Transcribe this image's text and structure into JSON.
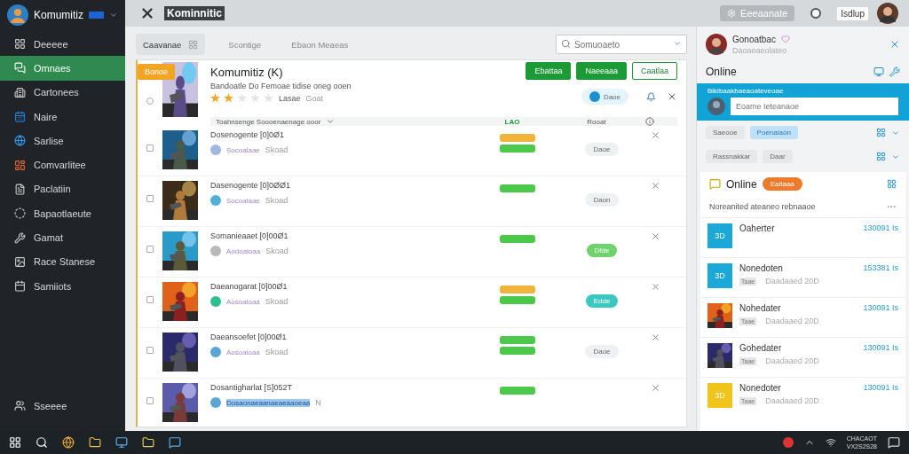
{
  "account": {
    "name": "Komumitiz"
  },
  "sidebar": {
    "items": [
      {
        "label": "Deeeee",
        "selected": false
      },
      {
        "label": "Omnaes",
        "selected": true
      },
      {
        "label": "Cartonees",
        "selected": false
      },
      {
        "label": "Naire",
        "selected": false
      },
      {
        "label": "Sarlise",
        "selected": false
      },
      {
        "label": "Comvarlitee",
        "selected": false
      },
      {
        "label": "Paclatiin",
        "selected": false
      },
      {
        "label": "Bapaotlaeute",
        "selected": false
      },
      {
        "label": "Gamat",
        "selected": false
      },
      {
        "label": "Race Stanese",
        "selected": false
      },
      {
        "label": "Samiiots",
        "selected": false
      }
    ],
    "footer": "Sseeee"
  },
  "header": {
    "title": "Kominnitic",
    "action": "Eeeaanate",
    "badge": "Isdlup"
  },
  "tabs": [
    {
      "label": "Caavanae",
      "selected": true
    },
    {
      "label": "Scontige",
      "selected": false
    },
    {
      "label": "Ebaon Meaeas",
      "selected": false
    }
  ],
  "search": {
    "placeholder": "Somuoaeto"
  },
  "actions": [
    {
      "label": "Ebattaa",
      "kind": "solid"
    },
    {
      "label": "Naeeaaa",
      "kind": "solid"
    },
    {
      "label": "Caatlaa",
      "kind": "outline"
    }
  ],
  "feature": {
    "badge": "Bonoe",
    "title": "Komumitiz (K)",
    "description": "Bandoatle Do Femoae tidise oneg ooen",
    "stars": 2,
    "rating_label": "Lasae",
    "rating_note": "Goat",
    "chip": "Daoe",
    "checked": false
  },
  "table": {
    "columns": [
      "Toahnsenge Soooenaenage ooor",
      "LAO",
      "Rooat"
    ],
    "rows": [
      {
        "title": "Dosenogente [0]0Ø1",
        "user": "Socoalaae",
        "meta": "Skoad",
        "checked": false,
        "highlighted": false,
        "color": "#9fb8e0",
        "statuses": [
          {
            "color": "#f1b43a"
          },
          {
            "color": "#4cc84a"
          }
        ],
        "chip": {
          "label": "Daoe",
          "color": "#eef1f3"
        }
      },
      {
        "title": "Dasenogente [0]0ØØ1",
        "user": "Socoalaae",
        "meta": "Skoad",
        "checked": false,
        "highlighted": false,
        "color": "#4fb0d8",
        "statuses": [
          {
            "color": "#4cc84a"
          }
        ],
        "chip": {
          "label": "Daon",
          "color": "#eef1f3"
        }
      },
      {
        "title": "Somanieaaet [0]00Ø1",
        "user": "Aodoaloaa",
        "meta": "Skoad",
        "checked": false,
        "highlighted": false,
        "color": "#b9b9b9",
        "statuses": [
          {
            "color": "#4cc84a"
          }
        ],
        "chip": {
          "label": "Dfde",
          "color": "#6dd36a"
        }
      },
      {
        "title": "Daeanogarat [0]00Ø1",
        "user": "Aosoaloaa",
        "meta": "Skoad",
        "checked": false,
        "highlighted": false,
        "color": "#2fbf8f",
        "statuses": [
          {
            "color": "#f1b43a"
          },
          {
            "color": "#4cc84a"
          }
        ],
        "chip": {
          "label": "Edde",
          "color": "#3cc8c0"
        }
      },
      {
        "title": "Daeansoefet [0]00Ø1",
        "user": "Aosoaloaa",
        "meta": "Skoad",
        "checked": false,
        "highlighted": false,
        "color": "#5aa6d6",
        "statuses": [
          {
            "color": "#4cc84a"
          },
          {
            "color": "#4cc84a"
          }
        ],
        "chip": {
          "label": "Daoe",
          "color": "#eef1f3"
        }
      },
      {
        "title": "Dosantigharlat [S]052T",
        "user": "Dosaonaeaanaeaeaaoeaa",
        "meta": "N",
        "checked": false,
        "highlighted": true,
        "color": "#5aa6d6",
        "statuses": [
          {
            "color": "#4cc84a"
          }
        ]
      }
    ]
  },
  "panel": {
    "profile": {
      "name": "Gonoatbac",
      "subtitle": "Daoaeaeolateo"
    },
    "status_title": "Online",
    "compose": {
      "label": "Bikibaakbaeaoateveoae",
      "placeholder": "Eoame Ieteanaoe"
    },
    "filters": [
      {
        "chips": [
          {
            "label": "Saeooe",
            "selected": false
          },
          {
            "label": "Poenaiaon",
            "selected": true
          }
        ]
      },
      {
        "chips": [
          {
            "label": "Rassnakkar",
            "selected": false
          },
          {
            "label": "Daar",
            "selected": false
          }
        ]
      }
    ],
    "section": {
      "title": "Online",
      "badge": "Eaitaaa",
      "notice": "Noreanited ateaneo rebnaaoe"
    },
    "contacts": [
      {
        "name": "Oaherter",
        "time": "130091 Is",
        "kind": "tile",
        "initials": "3D",
        "color": "#1ba8d8"
      },
      {
        "name": "Nonedoten",
        "tag": "Taae",
        "meta": "Daadaaed 20D",
        "time": "153381 Is",
        "kind": "tile",
        "initials": "3D",
        "color": "#1ba8d8"
      },
      {
        "name": "Nohedater",
        "tag": "Taae",
        "meta": "Daadaaed 20D",
        "time": "130091 Is",
        "kind": "picture"
      },
      {
        "name": "Gohedater",
        "tag": "Taae",
        "meta": "Daadaaed 20D",
        "time": "130091 Is",
        "kind": "picture"
      },
      {
        "name": "Nonedoter",
        "tag": "Taae",
        "meta": "Daadaaed 20D",
        "time": "130091 Is",
        "kind": "tile",
        "initials": "3D",
        "color": "#f0c419"
      }
    ]
  },
  "taskbar": {
    "time": "CHACAOT",
    "date": "VX2S2S28"
  }
}
